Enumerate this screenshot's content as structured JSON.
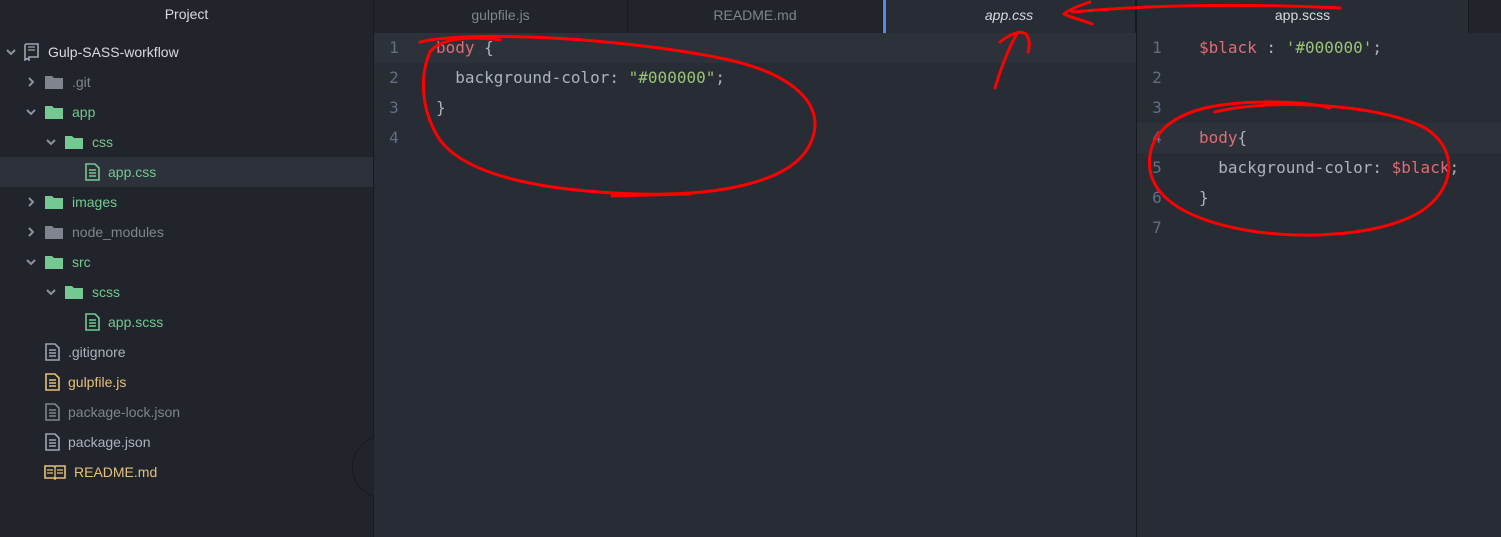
{
  "sidebar": {
    "title": "Project",
    "collapse_glyph": "‹",
    "items": [
      {
        "label": "Gulp-SASS-workflow",
        "icon": "repo-icon",
        "chevron": "open",
        "indent": 0,
        "color": "root"
      },
      {
        "label": ".git",
        "icon": "folder-icon",
        "chevron": "closed",
        "indent": 1,
        "color": "gray"
      },
      {
        "label": "app",
        "icon": "folder-icon",
        "chevron": "open",
        "indent": 1,
        "color": "green"
      },
      {
        "label": "css",
        "icon": "folder-icon",
        "chevron": "open",
        "indent": 2,
        "color": "green"
      },
      {
        "label": "app.css",
        "icon": "file-icon",
        "chevron": "none",
        "indent": 3,
        "color": "green",
        "selected": true
      },
      {
        "label": "images",
        "icon": "folder-icon",
        "chevron": "closed",
        "indent": 1,
        "color": "green"
      },
      {
        "label": "node_modules",
        "icon": "folder-icon",
        "chevron": "closed",
        "indent": 1,
        "color": "gray"
      },
      {
        "label": "src",
        "icon": "folder-icon",
        "chevron": "open",
        "indent": 1,
        "color": "green"
      },
      {
        "label": "scss",
        "icon": "folder-icon",
        "chevron": "open",
        "indent": 2,
        "color": "green"
      },
      {
        "label": "app.scss",
        "icon": "file-icon",
        "chevron": "none",
        "indent": 3,
        "color": "green"
      },
      {
        "label": ".gitignore",
        "icon": "file-icon",
        "chevron": "none",
        "indent": 1,
        "color": "light"
      },
      {
        "label": "gulpfile.js",
        "icon": "file-icon",
        "chevron": "none",
        "indent": 1,
        "color": "orange"
      },
      {
        "label": "package-lock.json",
        "icon": "file-icon",
        "chevron": "none",
        "indent": 1,
        "color": "gray"
      },
      {
        "label": "package.json",
        "icon": "file-icon",
        "chevron": "none",
        "indent": 1,
        "color": "light"
      },
      {
        "label": "README.md",
        "icon": "book-icon",
        "chevron": "none",
        "indent": 1,
        "color": "orange"
      }
    ]
  },
  "left_pane": {
    "tabs": [
      {
        "label": "gulpfile.js",
        "active": false
      },
      {
        "label": "README.md",
        "active": false
      },
      {
        "label": "app.css",
        "active": true
      }
    ],
    "lines": [
      {
        "num": "1",
        "tokens": [
          {
            "t": "body",
            "c": "kw"
          },
          {
            "t": " {",
            "c": "punc"
          }
        ]
      },
      {
        "num": "2",
        "tokens": [
          {
            "t": "  background-color: ",
            "c": "prop"
          },
          {
            "t": "\"#000000\"",
            "c": "str"
          },
          {
            "t": ";",
            "c": "punc"
          }
        ]
      },
      {
        "num": "3",
        "tokens": [
          {
            "t": "}",
            "c": "punc"
          }
        ]
      },
      {
        "num": "4",
        "tokens": []
      }
    ],
    "cursor_line": 0
  },
  "right_pane": {
    "tabs": [
      {
        "label": "app.scss",
        "active": true
      }
    ],
    "lines": [
      {
        "num": "1",
        "tokens": [
          {
            "t": "$black",
            "c": "var"
          },
          {
            "t": " : ",
            "c": "punc"
          },
          {
            "t": "'#000000'",
            "c": "str"
          },
          {
            "t": ";",
            "c": "punc"
          }
        ]
      },
      {
        "num": "2",
        "tokens": []
      },
      {
        "num": "3",
        "tokens": []
      },
      {
        "num": "4",
        "tokens": [
          {
            "t": "body",
            "c": "kw"
          },
          {
            "t": "{",
            "c": "punc"
          }
        ]
      },
      {
        "num": "5",
        "tokens": [
          {
            "t": "  background-color: ",
            "c": "prop"
          },
          {
            "t": "$black",
            "c": "var"
          },
          {
            "t": ";",
            "c": "punc"
          }
        ]
      },
      {
        "num": "6",
        "tokens": [
          {
            "t": "}",
            "c": "punc"
          }
        ]
      },
      {
        "num": "7",
        "tokens": []
      }
    ],
    "cursor_line": 3
  },
  "colors": {
    "sidebar_bg": "#21252b",
    "editor_bg": "#282c34",
    "active_tab_indicator": "#568af2",
    "annotation": "#ff0000"
  }
}
